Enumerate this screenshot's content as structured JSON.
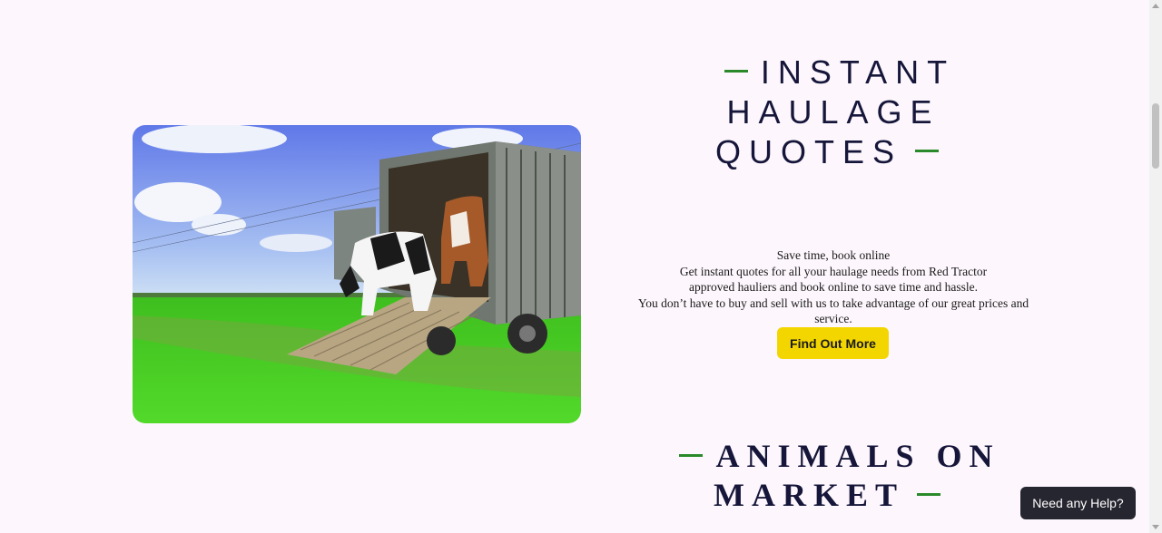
{
  "haulage": {
    "heading_line1": "INSTANT",
    "heading_line2": "HAULAGE",
    "heading_line3": "QUOTES",
    "lines": [
      "Save time, book online",
      "Get instant quotes for all your haulage needs from Red Tractor",
      "approved hauliers and book online to save time and hassle.",
      "You don’t have to buy and sell with us to take advantage of our great prices and service."
    ],
    "button_label": "Find Out More"
  },
  "animals": {
    "heading_line1": "ANIMALS ON",
    "heading_line2": "MARKET"
  },
  "help_widget": {
    "label": "Need any Help?"
  },
  "colors": {
    "accent_dash": "#2a8a2a",
    "button": "#f3d600",
    "heading": "#16163a",
    "background": "#fdf7fd"
  }
}
